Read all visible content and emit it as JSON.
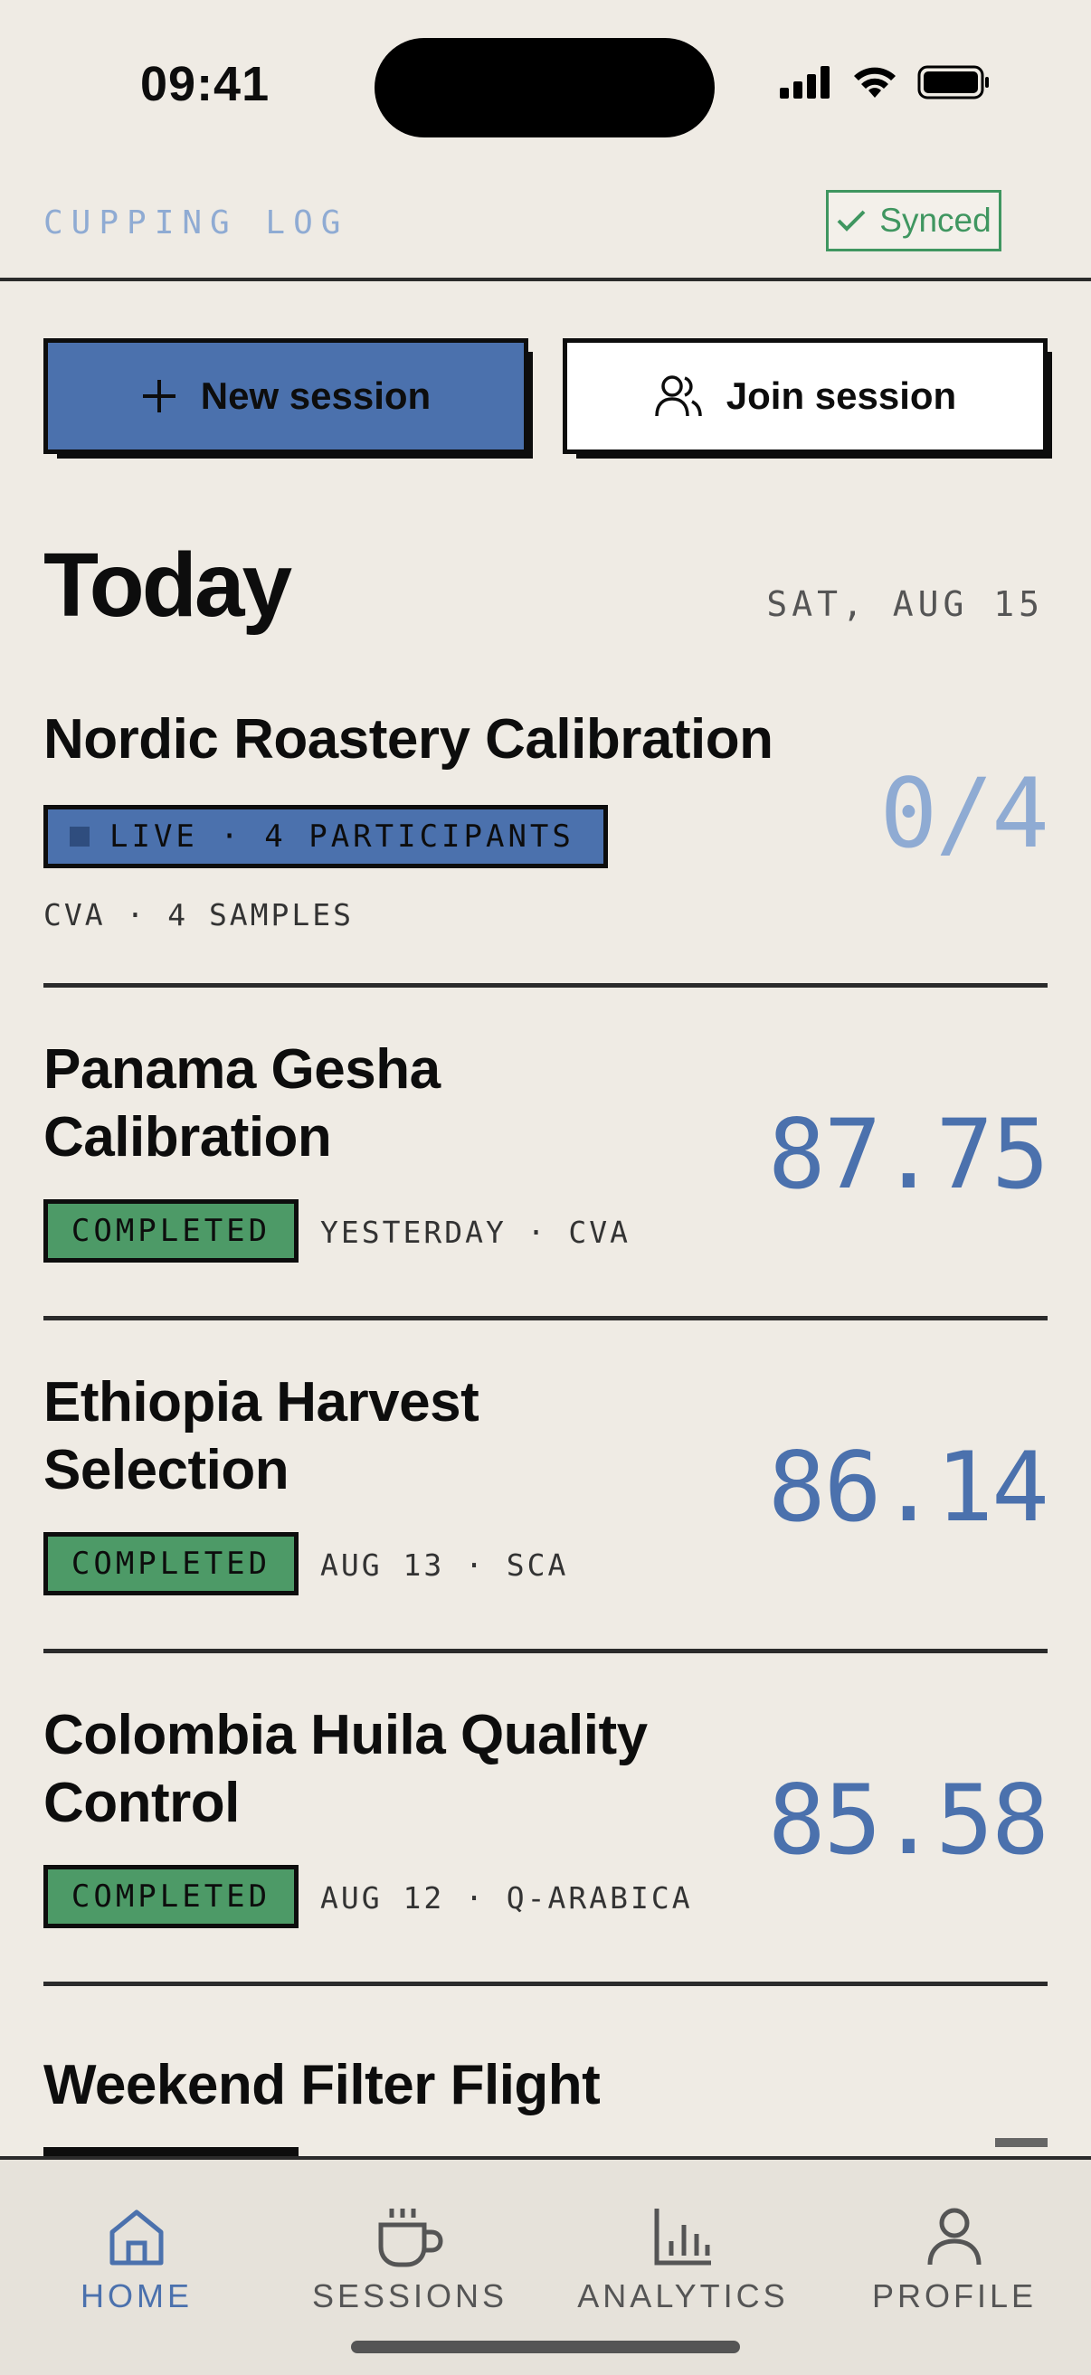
{
  "status_bar": {
    "time": "09:41"
  },
  "header": {
    "app_title": "CUPPING LOG",
    "sync_label": "Synced"
  },
  "actions": {
    "new_label": "New session",
    "join_label": "Join session"
  },
  "today": {
    "title": "Today",
    "date": "SAT, AUG 15"
  },
  "sessions": [
    {
      "title": "Nordic Roastery Calibration",
      "badge": "LIVE · 4 PARTICIPANTS",
      "meta": "CVA · 4 SAMPLES",
      "score": "0/4"
    },
    {
      "title_line1": "Panama Gesha",
      "title_line2": "Calibration",
      "badge": "COMPLETED",
      "meta": "YESTERDAY · CVA",
      "score": "87.75"
    },
    {
      "title_line1": "Ethiopia Harvest",
      "title_line2": "Selection",
      "badge": "COMPLETED",
      "meta": "AUG 13 · SCA",
      "score": "86.14"
    },
    {
      "title_line1": "Colombia Huila Quality",
      "title_line2": "Control",
      "badge": "COMPLETED",
      "meta": "AUG 12 · Q-ARABICA",
      "score": "85.58"
    },
    {
      "title": "Weekend Filter Flight"
    }
  ],
  "nav": [
    {
      "label": "HOME",
      "icon": "home-icon",
      "active": true
    },
    {
      "label": "SESSIONS",
      "icon": "cup-icon",
      "active": false
    },
    {
      "label": "ANALYTICS",
      "icon": "bar-chart-icon",
      "active": false
    },
    {
      "label": "PROFILE",
      "icon": "user-icon",
      "active": false
    }
  ],
  "colors": {
    "accent": "#4b71ad",
    "success": "#4d9a67",
    "background": "#efebe4"
  }
}
